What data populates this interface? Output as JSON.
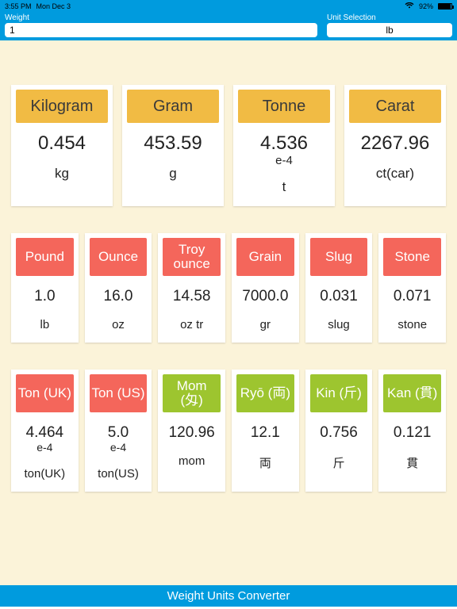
{
  "status": {
    "time": "3:55 PM",
    "date": "Mon Dec 3",
    "battery_pct": "92%"
  },
  "topbar": {
    "weight_label": "Weight",
    "weight_value": "1",
    "unit_label": "Unit Selection",
    "unit_value": "lb"
  },
  "rows": [
    {
      "cls": "r4",
      "cards": [
        {
          "color": "yellow",
          "name": "Kilogram",
          "value": "0.454",
          "exp": "",
          "sym": "kg"
        },
        {
          "color": "yellow",
          "name": "Gram",
          "value": "453.59",
          "exp": "",
          "sym": "g"
        },
        {
          "color": "yellow",
          "name": "Tonne",
          "value": "4.536",
          "exp": "e-4",
          "sym": "t"
        },
        {
          "color": "yellow",
          "name": "Carat",
          "value": "2267.96",
          "exp": "",
          "sym": "ct(car)"
        }
      ]
    },
    {
      "cls": "r6",
      "cards": [
        {
          "color": "red",
          "name": "Pound",
          "value": "1.0",
          "exp": "",
          "sym": "lb"
        },
        {
          "color": "red",
          "name": "Ounce",
          "value": "16.0",
          "exp": "",
          "sym": "oz"
        },
        {
          "color": "red",
          "name": "Troy ounce",
          "value": "14.58",
          "exp": "",
          "sym": "oz tr"
        },
        {
          "color": "red",
          "name": "Grain",
          "value": "7000.0",
          "exp": "",
          "sym": "gr"
        },
        {
          "color": "red",
          "name": "Slug",
          "value": "0.031",
          "exp": "",
          "sym": "slug"
        },
        {
          "color": "red",
          "name": "Stone",
          "value": "0.071",
          "exp": "",
          "sym": "stone"
        }
      ]
    },
    {
      "cls": "r6",
      "cards": [
        {
          "color": "red",
          "name": "Ton (UK)",
          "value": "4.464",
          "exp": "e-4",
          "sym": "ton(UK)"
        },
        {
          "color": "red",
          "name": "Ton (US)",
          "value": "5.0",
          "exp": "e-4",
          "sym": "ton(US)"
        },
        {
          "color": "green",
          "name": "Mom (匁)",
          "value": "120.96",
          "exp": "",
          "sym": "mom"
        },
        {
          "color": "green",
          "name": "Ryō (両)",
          "value": "12.1",
          "exp": "",
          "sym": "両"
        },
        {
          "color": "green",
          "name": "Kin (斤)",
          "value": "0.756",
          "exp": "",
          "sym": "斤"
        },
        {
          "color": "green",
          "name": "Kan (貫)",
          "value": "0.121",
          "exp": "",
          "sym": "貫"
        }
      ]
    }
  ],
  "footer": {
    "title": "Weight Units Converter"
  }
}
